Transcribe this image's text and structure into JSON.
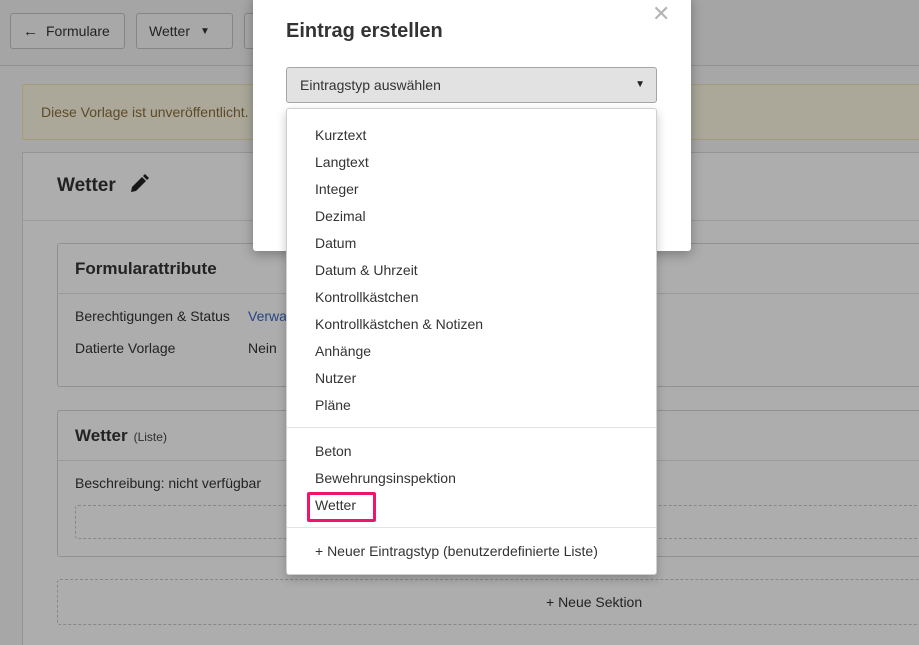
{
  "toolbar": {
    "back_label": "Formulare",
    "template_dropdown_label": "Wetter"
  },
  "banner": {
    "text": "Diese Vorlage ist unveröffentlicht."
  },
  "template": {
    "title": "Wetter"
  },
  "form_attributes": {
    "title": "Formularattribute",
    "rows": [
      {
        "label": "Berechtigungen & Status",
        "value": "Verwa"
      },
      {
        "label": "Datierte Vorlage",
        "value": "Nein"
      }
    ]
  },
  "section": {
    "title": "Wetter",
    "subtitle": "(Liste)",
    "description": "Beschreibung: nicht verfügbar"
  },
  "add_section_label": "+ Neue Sektion",
  "modal": {
    "title": "Eintrag erstellen",
    "select_value": "Eintragstyp auswählen"
  },
  "menu": {
    "group1": [
      "Kurztext",
      "Langtext",
      "Integer",
      "Dezimal",
      "Datum",
      "Datum & Uhrzeit",
      "Kontrollkästchen",
      "Kontrollkästchen & Notizen",
      "Anhänge",
      "Nutzer",
      "Pläne"
    ],
    "group2": [
      "Beton",
      "Bewehrungsinspektion",
      "Wetter"
    ],
    "new_type": "+ Neuer Eintragstyp (benutzerdefinierte Liste)"
  },
  "colors": {
    "highlight": "#f0156b",
    "link": "#3a66c4",
    "banner_bg": "#fcf8e3"
  }
}
